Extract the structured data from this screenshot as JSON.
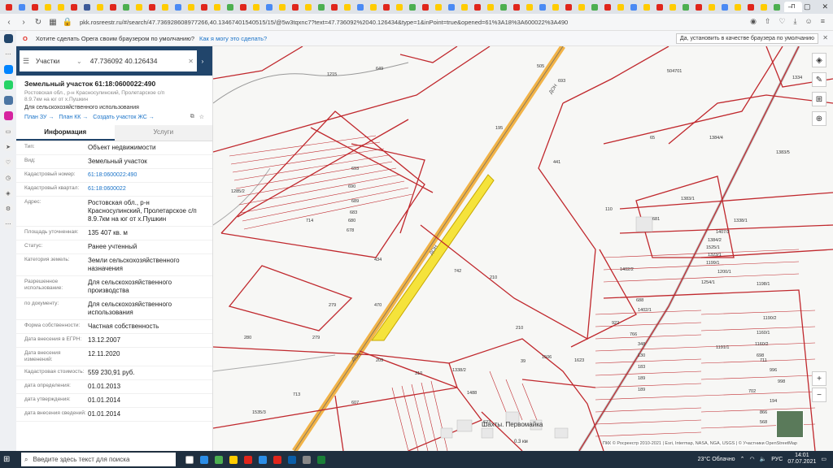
{
  "browser": {
    "url": "pkk.rosreestr.ru/#/search/47.736928608977266,40.13467401540515/15/@5w3tqxnc7?text=47.736092%2040.126434&type=1&inPoint=true&opened=61%3A18%3A600022%3A490",
    "active_tab_label": "П",
    "notice_text": "Хотите сделать Opera своим браузером по умолчанию?",
    "notice_link": "Как я могу это сделать?",
    "notice_accept": "Да, установить в качестве браузера по умолчанию"
  },
  "search": {
    "type_label": "Участки",
    "query": "47.736092 40.126434"
  },
  "parcel": {
    "title": "Земельный участок 61:18:0600022:490",
    "address_short": "Ростовская обл., р-н Красносулинский, Пролетарское с/п 8.9.7км на юг от х.Пушкин",
    "purpose": "Для сельскохозяйственного использования",
    "links": [
      "План ЗУ →",
      "План КК →",
      "Создать участок ЖС →"
    ],
    "tabs": [
      "Информация",
      "Услуги"
    ],
    "rows": [
      {
        "k": "Тип:",
        "v": "Объект недвижимости"
      },
      {
        "k": "Вид:",
        "v": "Земельный участок"
      },
      {
        "k": "Кадастровый номер:",
        "v": "61:18:0600022:490"
      },
      {
        "k": "Кадастровый квартал:",
        "v": "61:18:0600022"
      },
      {
        "k": "Адрес:",
        "v": "Ростовская обл., р-н Красносулинский, Пролетарское с/п 8.9.7км на юг от х.Пушкин"
      },
      {
        "k": "Площадь уточненная:",
        "v": "135 407 кв. м"
      },
      {
        "k": "Статус:",
        "v": "Ранее учтенный"
      },
      {
        "k": "Категория земель:",
        "v": "Земли сельскохозяйственного назначения"
      },
      {
        "k": "Разрешенное использование:",
        "v": "Для сельскохозяйственного производства"
      },
      {
        "k": "по документу:",
        "v": "Для сельскохозяйственного использования"
      },
      {
        "k": "Форма собственности:",
        "v": "Частная собственность"
      },
      {
        "k": "Дата внесения в ЕГРН:",
        "v": "13.12.2007"
      },
      {
        "k": "Дата внесения изменений:",
        "v": "12.11.2020"
      },
      {
        "k": "Кадастровая стоимость:",
        "v": "559 230,91 руб."
      },
      {
        "k": "дата определения:",
        "v": "01.01.2013"
      },
      {
        "k": "дата утверждения:",
        "v": "01.01.2014"
      },
      {
        "k": "дата внесения сведений:",
        "v": "01.01.2014"
      }
    ]
  },
  "map": {
    "labels": [
      "649",
      "1215",
      "505",
      "693",
      "195",
      "441",
      "504701",
      "1334",
      "1384/4",
      "1383/5",
      "1383/1",
      "1338/1",
      "1407/2",
      "1384/2",
      "1525/1",
      "1323/1",
      "1199/1",
      "1200/1",
      "1198/1",
      "1254/1",
      "110",
      "1402/2",
      "688",
      "1402/1",
      "922",
      "766",
      "348",
      "130",
      "183",
      "189",
      "189",
      "1191/1",
      "1190/2",
      "1160/1",
      "1160/2",
      "698",
      "711",
      "996",
      "998",
      "702",
      "194",
      "866",
      "568",
      "280",
      "279",
      "279",
      "434",
      "470",
      "742",
      "210",
      "210",
      "209",
      "310",
      "1338/2",
      "1488",
      "1506",
      "1623",
      "607",
      "623",
      "713",
      "1535/3",
      "1285/2",
      "693",
      "690",
      "689",
      "683",
      "680",
      "678",
      "714",
      "681",
      "39",
      "65"
    ],
    "place": "Шахты. Первомайка",
    "road_labels": [
      "ДОН",
      "ДОН",
      "ДОН"
    ],
    "attribution": "ПКК © Росреестр 2010-2021 | Esri, Intermap, NASA, NGA, USGS | © Участники OpenStreetMap",
    "scale": "0.3 км"
  },
  "taskbar": {
    "search_placeholder": "Введите здесь текст для поиска",
    "weather": "23°C Облачно",
    "lang": "РУС",
    "time": "14:01",
    "date": "07.07.2021"
  }
}
